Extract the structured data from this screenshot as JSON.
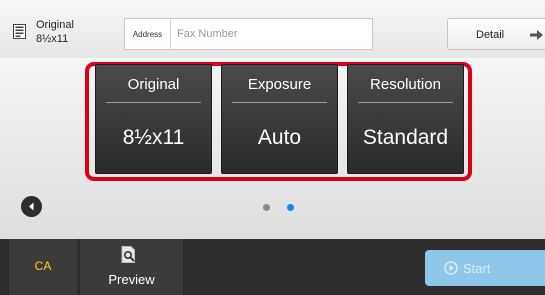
{
  "original_setting": {
    "line1": "Original",
    "line2": "8½x11",
    "icon": "document-icon"
  },
  "address": {
    "label": "Address",
    "placeholder": "Fax Number",
    "value": ""
  },
  "detail": {
    "label": "Detail",
    "icon": "arrow-right-icon"
  },
  "settings": [
    {
      "title": "Original",
      "value": "8½x11"
    },
    {
      "title": "Exposure",
      "value": "Auto"
    },
    {
      "title": "Resolution",
      "value": "Standard"
    }
  ],
  "pager": {
    "pages": 2,
    "active_page": 2
  },
  "bottom": {
    "ca_label": "CA",
    "preview_label": "Preview",
    "preview_icon": "document-magnifier-icon",
    "start_label": "Start",
    "start_icon": "start-icon",
    "start_enabled": false
  },
  "colors": {
    "highlight_frame": "#d9001b",
    "ca_text": "#ffd21a",
    "active_dot": "#1683ff",
    "start_button": "#8ec7ea"
  }
}
